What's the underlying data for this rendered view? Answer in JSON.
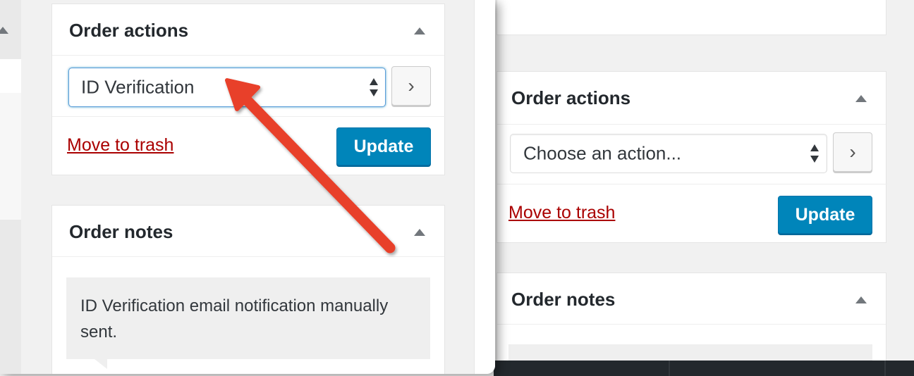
{
  "background_panel": {
    "order_actions": {
      "title": "Order actions",
      "select": {
        "value": "Choose an action..."
      },
      "go_button": "›",
      "move_to_trash": "Move to trash",
      "update_button": "Update"
    },
    "order_notes": {
      "title": "Order notes"
    }
  },
  "zoomed_panel": {
    "order_actions": {
      "title": "Order actions",
      "select": {
        "value": "ID Verification"
      },
      "go_button": "›",
      "move_to_trash": "Move to trash",
      "update_button": "Update"
    },
    "order_notes": {
      "title": "Order notes",
      "note_text": "ID Verification email notification manually sent."
    }
  },
  "annotation": {
    "arrow_color": "#e8412c",
    "icon": "pointer-arrow-icon"
  },
  "colors": {
    "link_red": "#a00",
    "button_blue": "#0085ba",
    "focus_blue": "#5b9dd9"
  }
}
